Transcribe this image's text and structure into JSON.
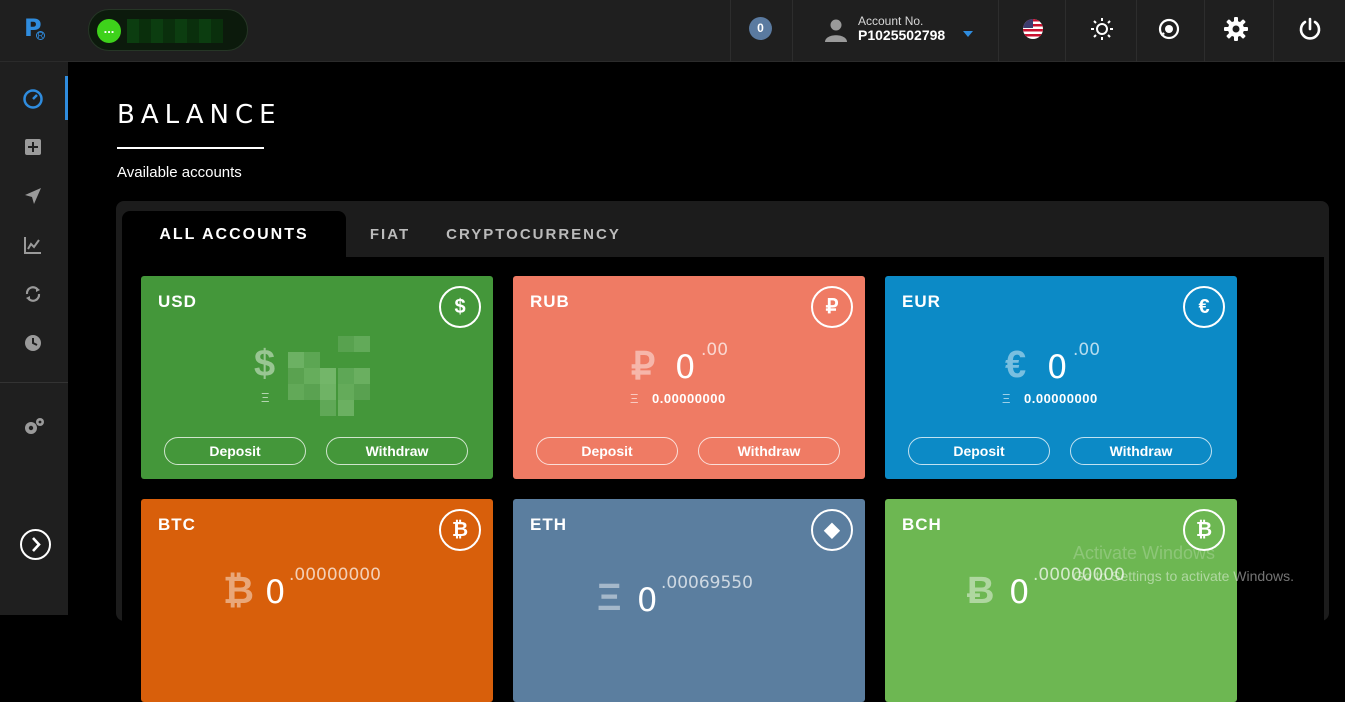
{
  "header": {
    "logo_letter": "P",
    "logo_mark": "R",
    "user_pill_icon": "...",
    "notifications_count": "0",
    "account_label": "Account No.",
    "account_number": "P1025502798",
    "icons": [
      "us-flag-icon",
      "brightness-icon",
      "support-chat-icon",
      "gear-icon",
      "power-icon"
    ]
  },
  "sidebar": {
    "items": [
      "dashboard-icon",
      "add-funds-icon",
      "send-icon",
      "chart-icon",
      "exchange-icon",
      "history-icon",
      "settings-icon"
    ],
    "expand_icon": "chevron-right-icon"
  },
  "page": {
    "title": "BALANCE",
    "subtitle": "Available accounts"
  },
  "tabs": [
    {
      "label": "ALL ACCOUNTS",
      "active": true
    },
    {
      "label": "FIAT",
      "active": false
    },
    {
      "label": "CRYPTOCURRENCY",
      "active": false
    }
  ],
  "cards": [
    {
      "currency": "USD",
      "symbol": "$",
      "icon_symbol": "$",
      "color": "#44973a",
      "sub_symbol": "Ξ",
      "deposit": "Deposit",
      "withdraw": "Withdraw"
    },
    {
      "currency": "RUB",
      "symbol": "₽",
      "icon_symbol": "₽",
      "color": "#ef7b64",
      "amount": "0",
      "decimals": ".00",
      "sub_symbol": "Ξ",
      "sub_amount": "0.00000000",
      "deposit": "Deposit",
      "withdraw": "Withdraw"
    },
    {
      "currency": "EUR",
      "symbol": "€",
      "icon_symbol": "€",
      "color": "#0c8ac6",
      "amount": "0",
      "decimals": ".00",
      "sub_symbol": "Ξ",
      "sub_amount": "0.00000000",
      "deposit": "Deposit",
      "withdraw": "Withdraw"
    },
    {
      "currency": "BTC",
      "symbol": "₿",
      "icon_symbol": "₿",
      "color": "#d85f0b",
      "amount": "0",
      "decimals": ".00000000"
    },
    {
      "currency": "ETH",
      "symbol": "Ξ",
      "icon_symbol": "◆",
      "color": "#5b7e9f",
      "amount": "0",
      "decimals": ".00069550"
    },
    {
      "currency": "BCH",
      "symbol": "Ƀ",
      "icon_symbol": "₿",
      "color": "#6db752",
      "amount": "0",
      "decimals": ".00000000"
    }
  ],
  "watermark": {
    "line1": "Activate Windows",
    "line2": "Go to Settings to activate Windows."
  }
}
